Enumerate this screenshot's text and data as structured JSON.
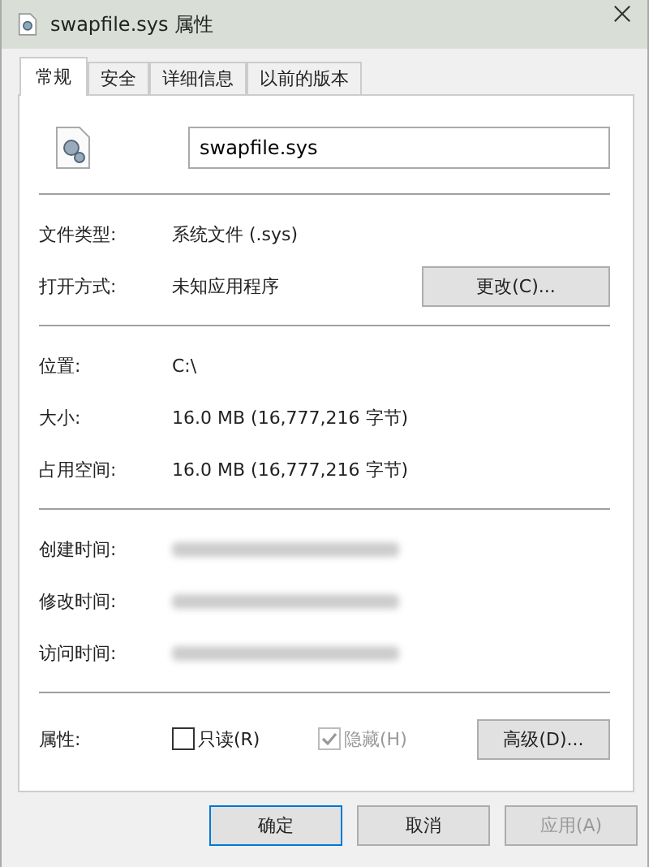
{
  "window": {
    "title": "swapfile.sys 属性"
  },
  "tabs": [
    {
      "label": "常规",
      "selected": true
    },
    {
      "label": "安全",
      "selected": false
    },
    {
      "label": "详细信息",
      "selected": false
    },
    {
      "label": "以前的版本",
      "selected": false
    }
  ],
  "file_name": "swapfile.sys",
  "sections": [
    [
      {
        "label": "文件类型:",
        "value": "系统文件 (.sys)"
      },
      {
        "label": "打开方式:",
        "value": "未知应用程序",
        "button": "更改(C)..."
      }
    ],
    [
      {
        "label": "位置:",
        "value": "C:\\"
      },
      {
        "label": "大小:",
        "value": "16.0 MB (16,777,216 字节)"
      },
      {
        "label": "占用空间:",
        "value": "16.0 MB (16,777,216 字节)"
      }
    ],
    [
      {
        "label": "创建时间:",
        "redacted": true
      },
      {
        "label": "修改时间:",
        "redacted": true
      },
      {
        "label": "访问时间:",
        "redacted": true
      }
    ]
  ],
  "attributes": {
    "label": "属性:",
    "checkboxes": [
      {
        "label": "只读(R)",
        "checked": false,
        "disabled": false
      },
      {
        "label": "隐藏(H)",
        "checked": true,
        "disabled": true
      }
    ],
    "button": "高级(D)..."
  },
  "buttons": [
    {
      "label": "确定",
      "disabled": false
    },
    {
      "label": "取消",
      "disabled": false
    },
    {
      "label": "应用(A)",
      "disabled": true
    }
  ]
}
